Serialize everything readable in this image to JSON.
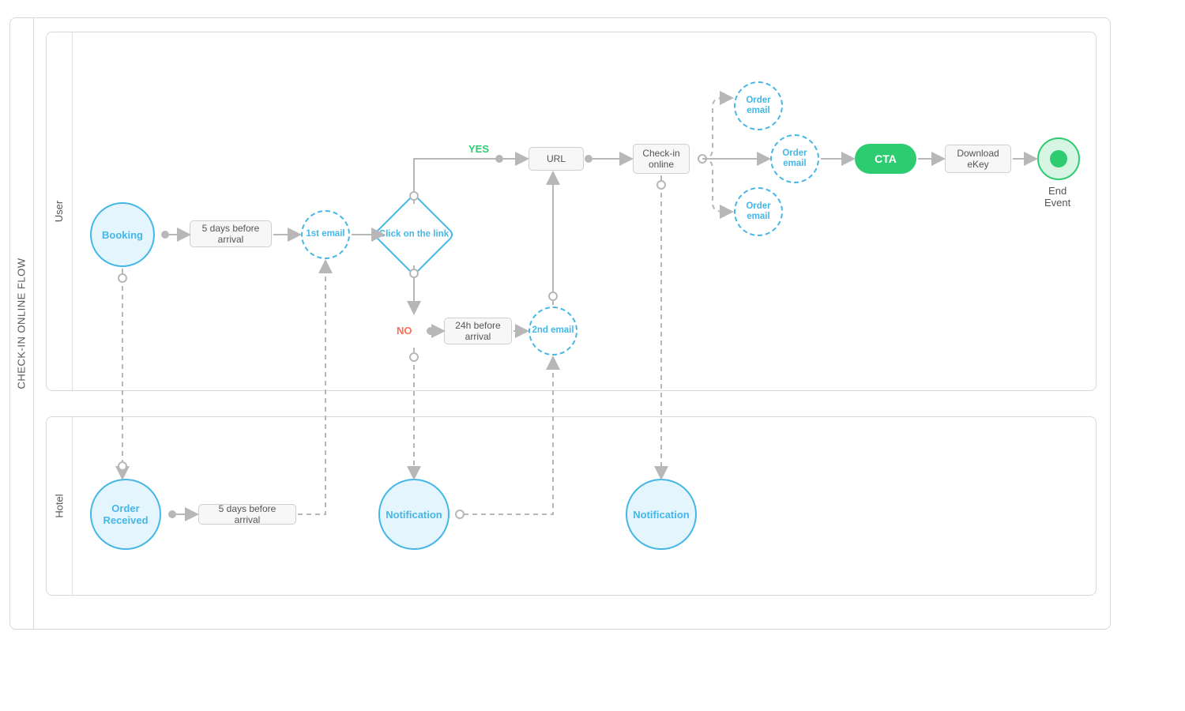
{
  "pool_title": "CHECK-IN ONLINE FLOW",
  "lanes": {
    "user": "User",
    "hotel": "Hotel"
  },
  "nodes": {
    "booking": "Booking",
    "five_days_user": "5 days before\narrival",
    "first_email": "1st\nemail",
    "click_link": "Click on\nthe link",
    "yes": "YES",
    "no": "NO",
    "url": "URL",
    "twenty_four_user": "24h before\narrival",
    "second_email": "2nd\nemail",
    "checkin_online": "Check-in\nonline",
    "order_email": "Order\nemail",
    "cta": "CTA",
    "download_ekey": "Download\neKey",
    "end_event": "End\nEvent",
    "order_received": "Order\nReceived",
    "five_days_hotel": "5 days before arrival",
    "notification": "Notification"
  },
  "colors": {
    "blue": "#45b7e6",
    "green": "#2ecc71",
    "red": "#ff6b57",
    "gray": "#b7b7b7"
  }
}
